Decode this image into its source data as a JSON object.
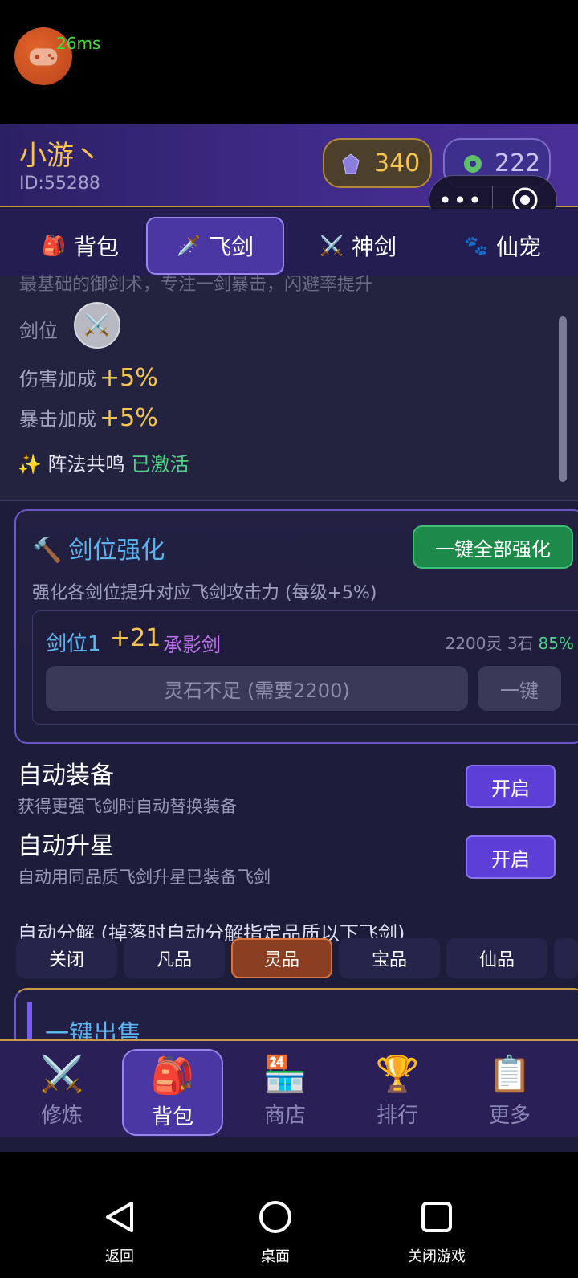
{
  "ping": {
    "text": "26ms"
  },
  "header": {
    "username": "小游丶",
    "user_id": "ID:55288",
    "currency_gem": "340",
    "currency_jade": "222",
    "capsule_more": "•••"
  },
  "tabs": [
    {
      "label": "背包",
      "icon": "🎒"
    },
    {
      "label": "飞剑",
      "icon": "🗡️"
    },
    {
      "label": "神剑",
      "icon": "⚔️"
    },
    {
      "label": "仙宠",
      "icon": "🐾"
    }
  ],
  "detail": {
    "faded_text": "最基础的御剑术，专注一剑暴击，闪避率提升",
    "slot_label": "剑位",
    "slot_icon": "⚔️",
    "damage_label": "伤害加成",
    "damage_value": "+5%",
    "crit_label": "暴击加成",
    "crit_value": "+5%",
    "resonance_icon": "✨",
    "resonance_label": "阵法共鸣",
    "resonance_status": "已激活"
  },
  "enhance": {
    "icon": "🔨",
    "title": "剑位强化",
    "all_button": "一键全部强化",
    "description": "强化各剑位提升对应飞剑攻击力 (每级+5%)",
    "slot": {
      "name": "剑位1",
      "level": "+21",
      "sword": "承影剑",
      "cost": "2200灵 3石",
      "rate": "85%",
      "insufficient": "灵石不足 (需要2200)",
      "one_key": "一键"
    }
  },
  "options": {
    "auto_equip_title": "自动装备",
    "auto_equip_desc": "获得更强飞剑时自动替换装备",
    "auto_equip_btn": "开启",
    "auto_star_title": "自动升星",
    "auto_star_desc": "自动用同品质飞剑升星已装备飞剑",
    "auto_star_btn": "开启",
    "decompose_title": "自动分解 (掉落时自动分解指定品质以下飞剑)",
    "qualities": [
      "关闭",
      "凡品",
      "灵品",
      "宝品",
      "仙品"
    ],
    "selected_quality": "灵品"
  },
  "sell": {
    "title": "一键出售"
  },
  "bottom_nav": [
    {
      "label": "修炼",
      "icon": "⚔️"
    },
    {
      "label": "背包",
      "icon": "🎒"
    },
    {
      "label": "商店",
      "icon": "🏪"
    },
    {
      "label": "排行",
      "icon": "🏆"
    },
    {
      "label": "更多",
      "icon": "📋"
    }
  ],
  "system_nav": {
    "back": "返回",
    "home": "桌面",
    "close": "关闭游戏"
  },
  "colors": {
    "gold": "#f5c451",
    "blue": "#5cb5f0",
    "green": "#4fd38a",
    "purple": "#5c3fd6"
  }
}
